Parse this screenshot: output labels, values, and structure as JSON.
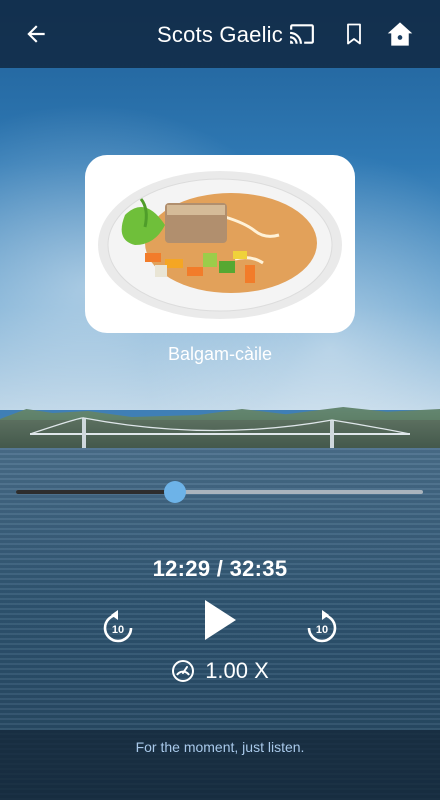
{
  "header": {
    "title": "Scots Gaelic",
    "back_icon": "arrow-left-icon",
    "cast_icon": "cast-icon",
    "bookmark_icon": "bookmark-icon",
    "home_icon": "home-icon"
  },
  "lesson": {
    "image_icon": "food-photo",
    "caption": "Balgam-càile"
  },
  "player": {
    "progress_fraction": 0.39,
    "time_label": "12:29 / 32:35",
    "rewind_label": "10",
    "forward_label": "10",
    "speed_label": "1.00 X",
    "accent_color": "#6db3e8"
  },
  "footer": {
    "message": "For the moment, just listen."
  }
}
